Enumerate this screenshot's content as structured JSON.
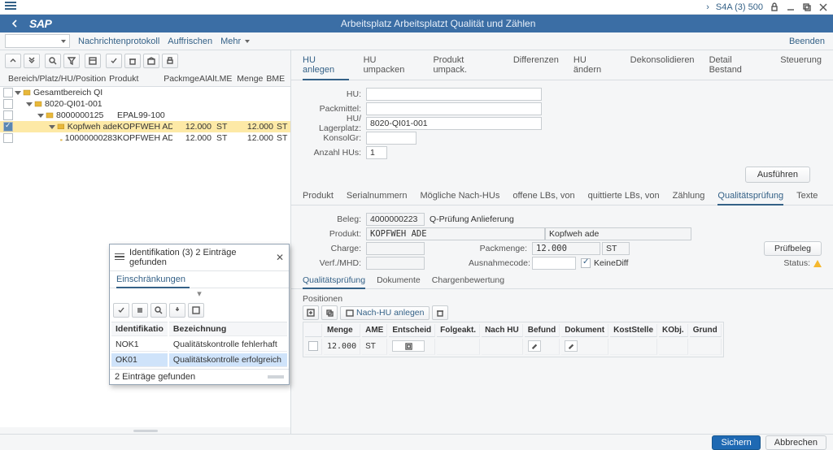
{
  "system": {
    "left_menu": "≡",
    "env": "S4A (3) 500",
    "arrow": "›"
  },
  "header": {
    "title": "Arbeitsplatz Arbeitsplatzt Qualität und Zählen"
  },
  "toolbar2": {
    "nachrichten": "Nachrichtenprotokoll",
    "auffrischen": "Auffrischen",
    "mehr": "Mehr",
    "beenden": "Beenden"
  },
  "tree": {
    "headers": {
      "c1": "Bereich/Platz/HU/Position",
      "c2": "Produkt",
      "c3": "PackmgeAME",
      "c4": "Alt.ME",
      "c5": "Menge",
      "c6": "BME"
    },
    "rows": [
      {
        "text": "Gesamtbereich QI",
        "indent": 0,
        "expand": true,
        "icon": "range-icon"
      },
      {
        "text": "8020-QI01-001",
        "indent": 1,
        "expand": true,
        "icon": "bin-icon"
      },
      {
        "text": "8000000125",
        "indent": 2,
        "expand": true,
        "icon": "hu-icon",
        "c2": "EPAL99-100"
      },
      {
        "text": "Kopfweh ade",
        "indent": 3,
        "expand": true,
        "icon": "prod-icon",
        "sel": true,
        "chk": true,
        "c2": "KOPFWEH ADE",
        "c3": "12.000",
        "c4": "ST",
        "c5": "12.000",
        "c6": "ST"
      },
      {
        "text": "10000000283",
        "indent": 4,
        "icon": "item-icon",
        "c2": "KOPFWEH ADE",
        "c3": "12.000",
        "c4": "ST",
        "c5": "12.000",
        "c6": "ST"
      }
    ]
  },
  "ident": {
    "title": "Identifikation (3)   2 Einträge gefunden",
    "tab": "Einschränkungen",
    "col1": "Identifikatio",
    "col2": "Bezeichnung",
    "rows": [
      {
        "id": "NOK1",
        "desc": "Qualitätskontrolle fehlerhaft"
      },
      {
        "id": "OK01",
        "desc": "Qualitätskontrolle erfolgreich"
      }
    ],
    "footer": "2 Einträge gefunden"
  },
  "tabs_main": [
    "HU anlegen",
    "HU umpacken",
    "Produkt umpack.",
    "Differenzen",
    "HU ändern",
    "Dekonsolidieren",
    "Detail Bestand",
    "Steuerung"
  ],
  "form": {
    "hu": {
      "lbl": "HU:"
    },
    "packmittel": {
      "lbl": "Packmittel:"
    },
    "hulager": {
      "lbl": "HU/ Lagerplatz:",
      "val": "8020-QI01-001"
    },
    "konsol": {
      "lbl": "KonsolGr:"
    },
    "anzahl": {
      "lbl": "Anzahl HUs:",
      "val": "1"
    },
    "exec": "Ausführen"
  },
  "subtabs": [
    "Produkt",
    "Serialnummern",
    "Mögliche Nach-HUs",
    "offene LBs, von",
    "quittierte LBs, von",
    "Zählung",
    "Qualitätsprüfung",
    "Texte"
  ],
  "qform": {
    "beleg": {
      "lbl": "Beleg:",
      "val": "4000000223",
      "txt": "Q-Prüfung Anlieferung"
    },
    "produkt": {
      "lbl": "Produkt:",
      "val": "KOPFWEH  ADE",
      "txt": "Kopfweh ade"
    },
    "charge": {
      "lbl": "Charge:"
    },
    "packmenge": {
      "lbl": "Packmenge:",
      "val": "12.000",
      "me": "ST"
    },
    "prufbeleg": "Prüfbeleg",
    "verfmhd": {
      "lbl": "Verf./MHD:"
    },
    "ausnahme": {
      "lbl": "Ausnahmecode:"
    },
    "keinediff": "KeineDiff",
    "status": "Status:"
  },
  "subsubtabs": [
    "Qualitätsprüfung",
    "Dokumente",
    "Chargenbewertung"
  ],
  "pos": {
    "header": "Positionen",
    "nachhu": "Nach-HU anlegen",
    "cols": [
      "",
      "Menge",
      "AME",
      "Entscheid",
      "Folgeakt.",
      "Nach HU",
      "Befund",
      "Dokument",
      "KostStelle",
      "KObj.",
      "Grund"
    ],
    "row": {
      "menge": "12.000",
      "ame": "ST"
    }
  },
  "footer": {
    "save": "Sichern",
    "cancel": "Abbrechen"
  }
}
